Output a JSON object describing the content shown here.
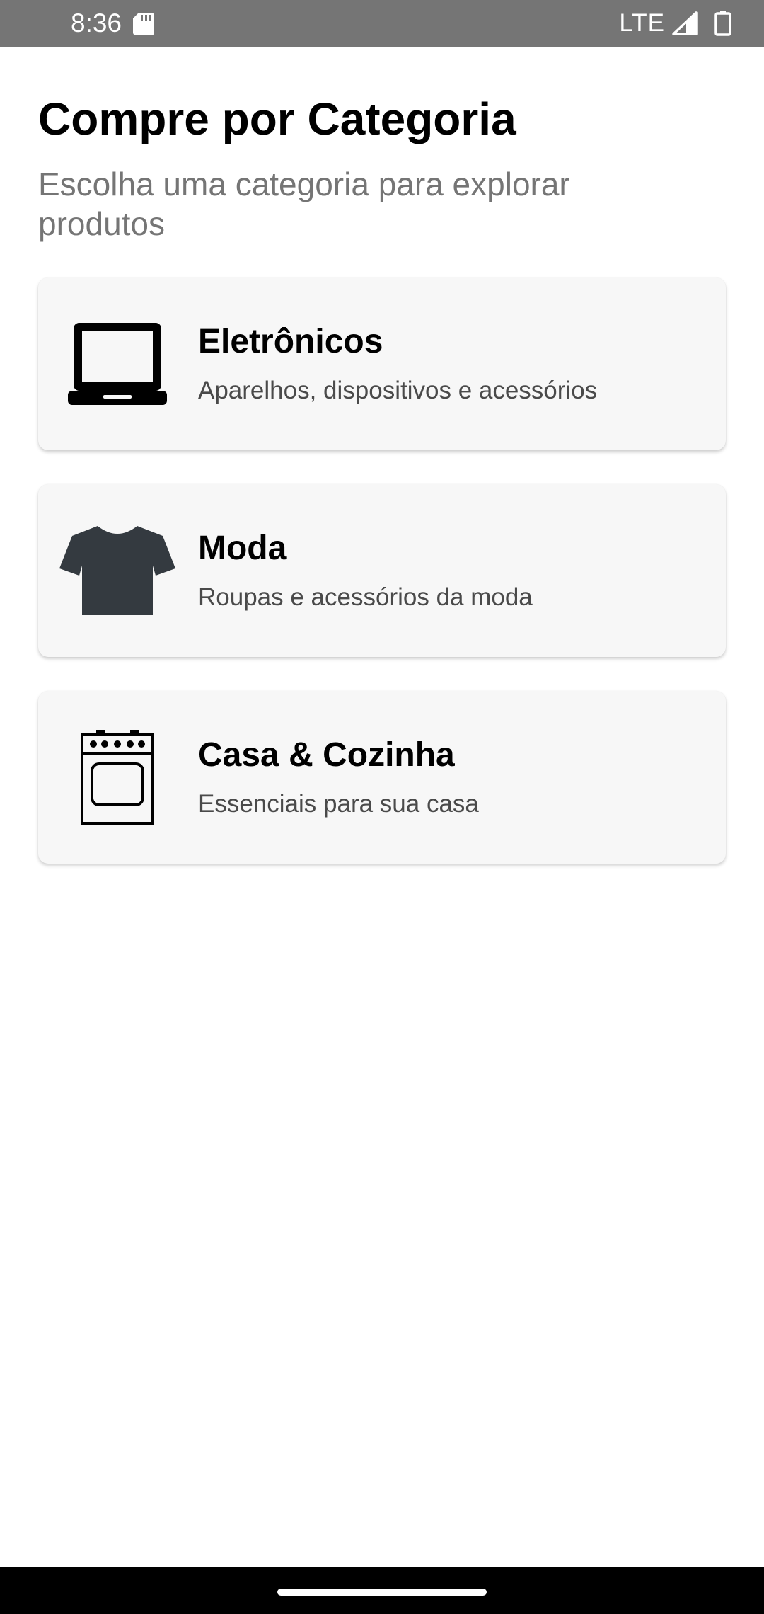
{
  "status_bar": {
    "time": "8:36",
    "network": "LTE",
    "icons": [
      "sd-card-icon",
      "signal-icon",
      "battery-icon"
    ]
  },
  "header": {
    "title": "Compre por Categoria",
    "subtitle": "Escolha uma categoria para explorar produtos"
  },
  "categories": [
    {
      "icon": "laptop-icon",
      "title": "Eletrônicos",
      "description": "Aparelhos, dispositivos e acessórios"
    },
    {
      "icon": "tshirt-icon",
      "title": "Moda",
      "description": "Roupas e acessórios da moda"
    },
    {
      "icon": "stove-icon",
      "title": "Casa & Cozinha",
      "description": "Essenciais para sua casa"
    }
  ],
  "colors": {
    "status_bar": "#757575",
    "card_background": "#f7f7f7",
    "tshirt": "#343a40",
    "subtitle_text": "#757575"
  }
}
